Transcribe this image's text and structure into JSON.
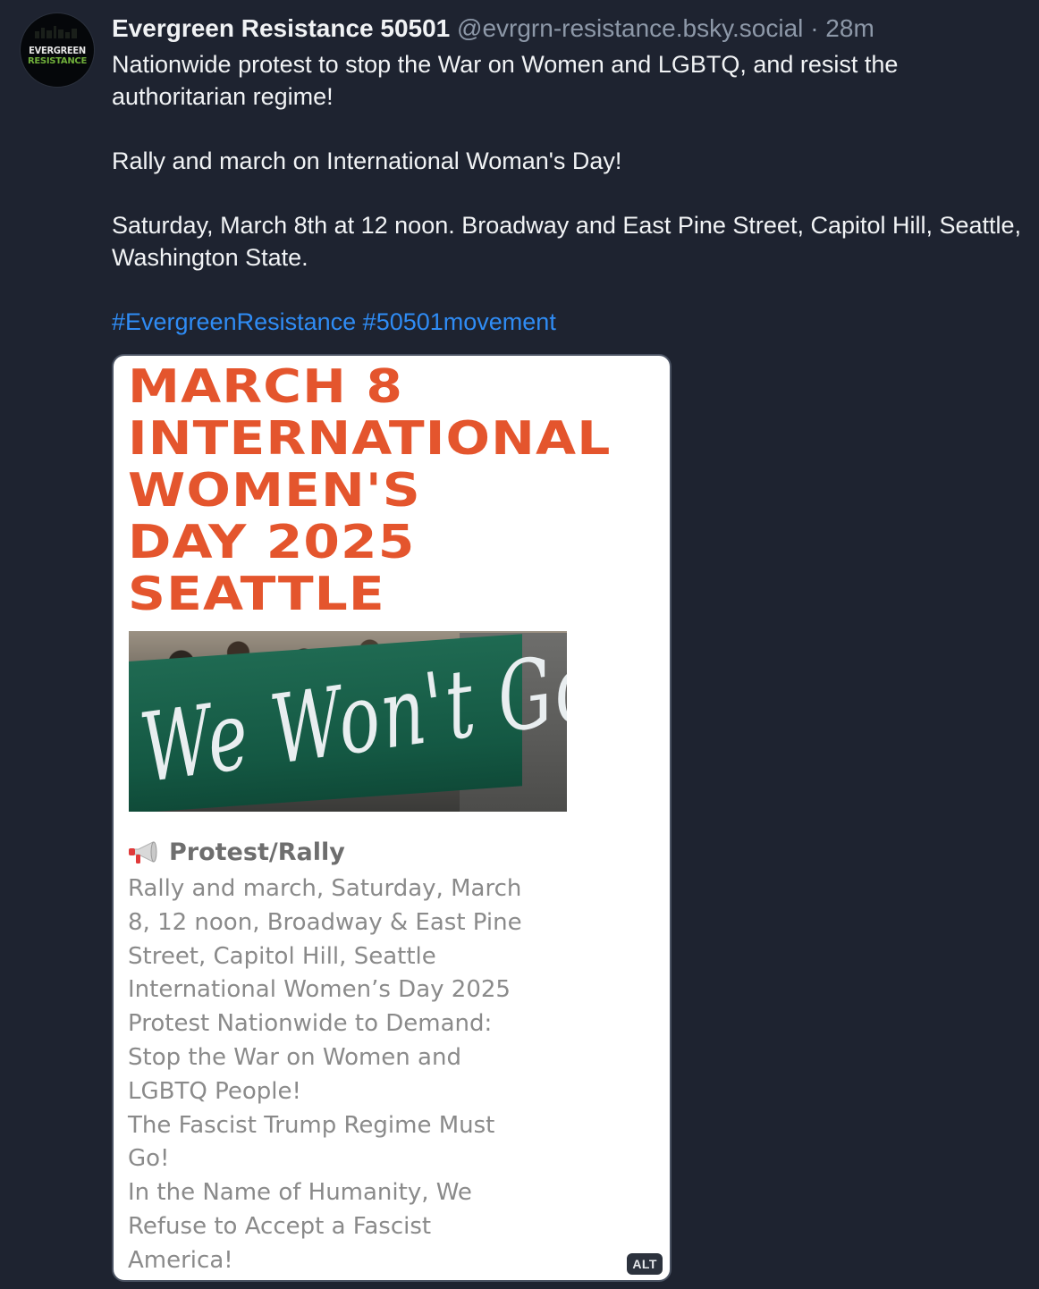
{
  "author": {
    "avatar_line1": "EVERGREEN",
    "avatar_line2": "RESISTANCE",
    "display_name": "Evergreen Resistance 50501",
    "handle": "@evrgrn-resistance.bsky.social",
    "separator": "·",
    "time_ago": "28m"
  },
  "post": {
    "line1": "Nationwide protest to stop the War on Women and LGBTQ, and resist the authoritarian regime!",
    "line2": "Rally and march on International Woman's Day!",
    "line3": "Saturday, March 8th at 12 noon. Broadway and East Pine Street, Capitol Hill, Seattle, Washington State.",
    "hashtags": [
      "#EvergreenResistance",
      "#50501movement"
    ]
  },
  "embed": {
    "headline": [
      "MARCH 8",
      "INTERNATIONAL",
      "WOMEN'S",
      "DAY 2025",
      "SEATTLE"
    ],
    "banner_text": "We Won't Go Back",
    "section_title": "Protest/Rally",
    "section_icon": "megaphone-icon",
    "body_lines": [
      "Rally and march, Saturday, March",
      "8, 12 noon, Broadway & East Pine",
      "Street, Capitol Hill, Seattle",
      "International Women’s Day 2025",
      "Protest Nationwide to Demand:",
      "Stop the War on Women and",
      "LGBTQ People!",
      "The Fascist Trump Regime Must",
      "Go!",
      "In the Name of Humanity, We",
      "Refuse to Accept a Fascist",
      "America!"
    ],
    "alt_label": "ALT"
  },
  "colors": {
    "background": "#1e2330",
    "link": "#2f8cf5",
    "headline": "#e4552d",
    "muted": "#8d98a8"
  }
}
